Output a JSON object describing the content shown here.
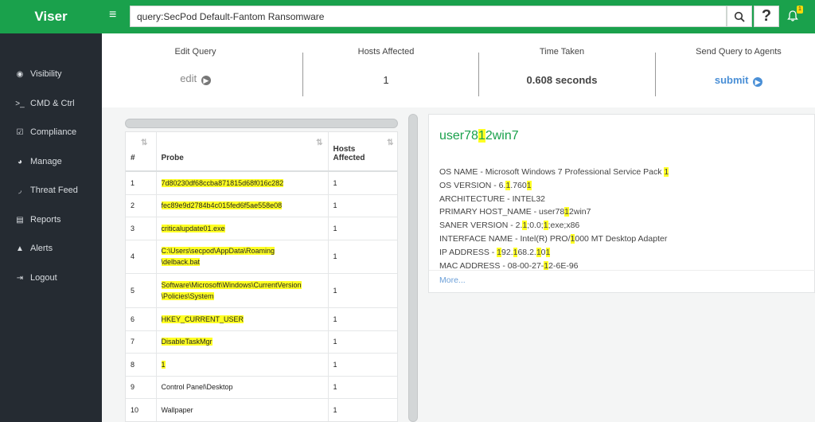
{
  "app": {
    "brand": "Viser",
    "notification_count": "1"
  },
  "search": {
    "query": "query:SecPod Default-Fantom Ransomware"
  },
  "sidebar": {
    "items": [
      {
        "label": "Visibility",
        "icon": "eye-icon"
      },
      {
        "label": "CMD & Ctrl",
        "icon": "terminal-icon"
      },
      {
        "label": "Compliance",
        "icon": "checkbox-icon"
      },
      {
        "label": "Manage",
        "icon": "pie-chart-icon"
      },
      {
        "label": "Threat Feed",
        "icon": "rss-icon"
      },
      {
        "label": "Reports",
        "icon": "report-icon"
      },
      {
        "label": "Alerts",
        "icon": "warning-icon"
      },
      {
        "label": "Logout",
        "icon": "logout-icon"
      }
    ]
  },
  "stats": {
    "edit_query_label": "Edit Query",
    "edit_link": "edit",
    "hosts_affected_label": "Hosts Affected",
    "hosts_affected_value": "1",
    "time_taken_label": "Time Taken",
    "time_taken_value": "0.608 seconds",
    "send_query_label": "Send Query to Agents",
    "submit_link": "submit"
  },
  "table": {
    "headers": {
      "num": "#",
      "probe": "Probe",
      "hosts_line1": "Hosts",
      "hosts_line2": "Affected"
    },
    "rows": [
      {
        "num": "1",
        "probe": "7d80230df68ccba871815d68f016c282",
        "hosts": "1",
        "highlight": true
      },
      {
        "num": "2",
        "probe": "fec89e9d2784b4c015fed6f5ae558e08",
        "hosts": "1",
        "highlight": true
      },
      {
        "num": "3",
        "probe": "criticalupdate01.exe",
        "hosts": "1",
        "highlight": true
      },
      {
        "num": "4",
        "probe_line1": "C:\\Users\\secpod\\AppData\\Roaming",
        "probe_line2": "\\delback.bat",
        "hosts": "1",
        "highlight": true
      },
      {
        "num": "5",
        "probe_line1": "Software\\Microsoft\\Windows\\CurrentVersion",
        "probe_line2": "\\Policies\\System",
        "hosts": "1",
        "highlight": true
      },
      {
        "num": "6",
        "probe": "HKEY_CURRENT_USER",
        "hosts": "1",
        "highlight": true
      },
      {
        "num": "7",
        "probe": "DisableTaskMgr",
        "hosts": "1",
        "highlight": true
      },
      {
        "num": "8",
        "probe": "1",
        "hosts": "1",
        "highlight": true
      },
      {
        "num": "9",
        "probe": "Control Panel\\Desktop",
        "hosts": "1",
        "highlight": false
      },
      {
        "num": "10",
        "probe": "Wallpaper",
        "hosts": "1",
        "highlight": false
      }
    ]
  },
  "detail": {
    "host_name_parts": [
      "user78",
      "1",
      "2win7"
    ],
    "lines": [
      {
        "parts": [
          "OS NAME - Microsoft Windows 7 Professional Service Pack ",
          "1"
        ]
      },
      {
        "parts": [
          "OS VERSION - 6.",
          "1",
          ".760",
          "1"
        ]
      },
      {
        "parts": [
          "ARCHITECTURE - INTEL32"
        ]
      },
      {
        "parts": [
          "PRIMARY HOST_NAME - user78",
          "1",
          "2win7"
        ]
      },
      {
        "parts": [
          "SANER VERSION - 2.",
          "1",
          ";0.0;",
          "1",
          ";exe;x86"
        ]
      },
      {
        "parts": [
          "INTERFACE NAME - Intel(R) PRO/",
          "1",
          "000 MT Desktop Adapter"
        ]
      },
      {
        "parts": [
          "IP ADDRESS - ",
          "1",
          "92.",
          "1",
          "68.2.",
          "1",
          "0",
          "1"
        ]
      },
      {
        "parts": [
          "MAC ADDRESS - 08-00-27-",
          "1",
          "2-6E-96"
        ]
      }
    ],
    "more_link": "More..."
  },
  "colors": {
    "brand_green": "#1aa14c",
    "sidebar_bg": "#252b32",
    "highlight": "#ffff24",
    "link_blue": "#4a8fd6"
  }
}
